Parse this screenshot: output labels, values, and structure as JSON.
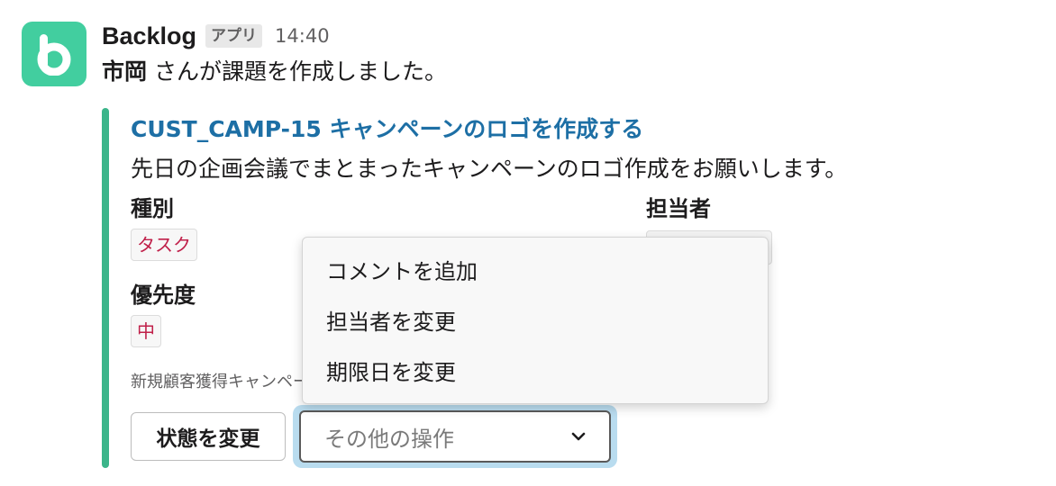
{
  "header": {
    "sender": "Backlog",
    "app_badge": "アプリ",
    "timestamp": "14:40"
  },
  "message": {
    "user": "市岡",
    "text": " さんが課題を作成しました。"
  },
  "issue": {
    "title": "CUST_CAMP-15 キャンペーンのロゴを作成する",
    "description": "先日の企画会議でまとまったキャンペーンのロゴ作成をお願いします。",
    "fields": {
      "type_label": "種別",
      "type_value": "タスク",
      "priority_label": "優先度",
      "priority_value": "中",
      "assignee_label": "担当者"
    },
    "footer": "新規顧客獲得キャンペーン"
  },
  "actions": {
    "change_status_button": "状態を変更",
    "other_actions_placeholder": "その他の操作",
    "menu_items": [
      "コメントを追加",
      "担当者を変更",
      "期限日を変更"
    ]
  },
  "colors": {
    "avatar_bg": "#42ce9f",
    "attachment_bar": "#3bb58a",
    "link": "#1d6fa5",
    "tag_text": "#c0204a",
    "focus_ring": "#b9dcef"
  },
  "icons": {
    "avatar": "backlog-logo-icon",
    "dropdown": "chevron-down-icon"
  }
}
